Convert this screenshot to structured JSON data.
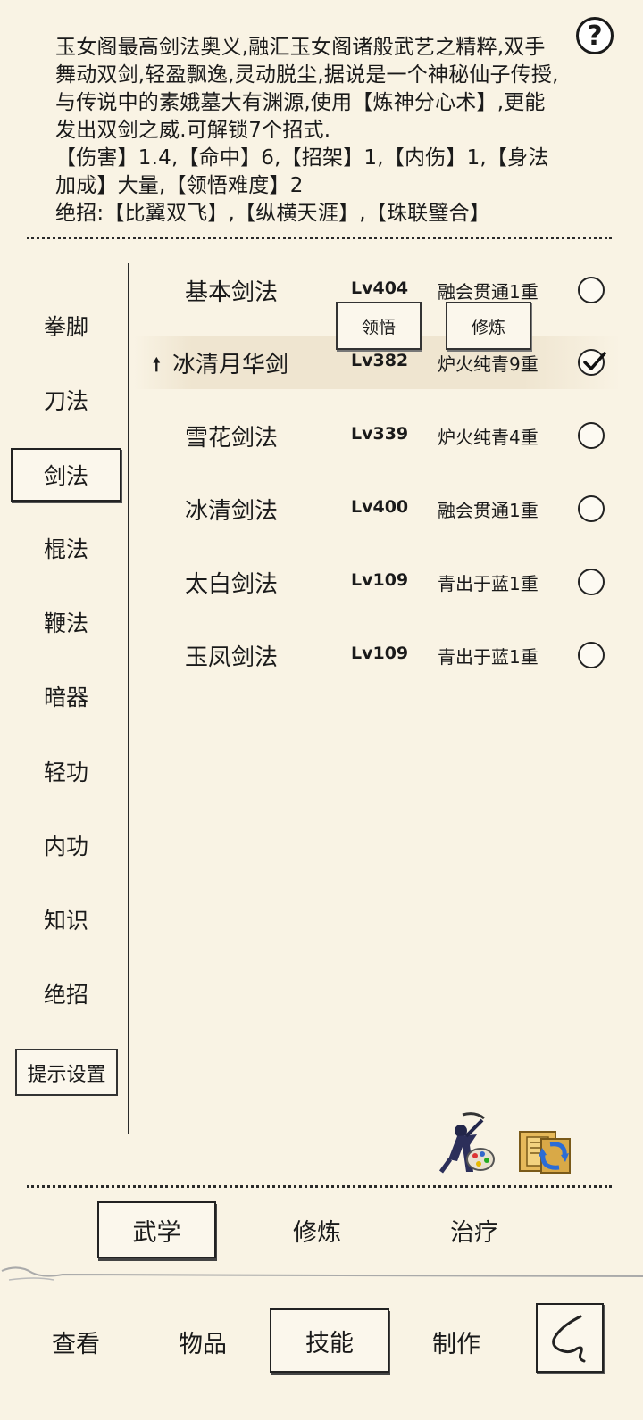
{
  "description": {
    "lines": [
      "玉女阁最高剑法奥义,融汇玉女阁诸般武艺之精粹,双手",
      "舞动双剑,轻盈飘逸,灵动脱尘,据说是一个神秘仙子传授,",
      "与传说中的素娥墓大有渊源,使用【炼神分心术】,更能",
      "发出双剑之威.可解锁7个招式.",
      "【伤害】1.4,【命中】6,【招架】1,【内伤】1,【身法",
      "加成】大量,【领悟难度】2",
      "绝招:【比翼双飞】,【纵横天涯】,【珠联璧合】"
    ]
  },
  "help_icon": "question-icon",
  "sidebar": {
    "items": [
      "拳脚",
      "刀法",
      "剑法",
      "棍法",
      "鞭法",
      "暗器",
      "轻功",
      "内功",
      "知识",
      "绝招"
    ],
    "active": "剑法",
    "hint_button": "提示设置"
  },
  "skills": [
    {
      "name": "基本剑法",
      "level": "Lv404",
      "status": "融会贯通1重",
      "checked": false
    },
    {
      "name": "冰清月华剑",
      "level": "Lv382",
      "status": "炉火纯青9重",
      "checked": true
    },
    {
      "name": "雪花剑法",
      "level": "Lv339",
      "status": "炉火纯青4重",
      "checked": false
    },
    {
      "name": "冰清剑法",
      "level": "Lv400",
      "status": "融会贯通1重",
      "checked": false
    },
    {
      "name": "太白剑法",
      "level": "Lv109",
      "status": "青出于蓝1重",
      "checked": false
    },
    {
      "name": "玉凤剑法",
      "level": "Lv109",
      "status": "青出于蓝1重",
      "checked": false
    }
  ],
  "popup_buttons": {
    "comprehend": "领悟",
    "practice": "修炼"
  },
  "tool_icons": [
    "martial-artist-palette-icon",
    "scroll-swap-icon"
  ],
  "sub_tabs": {
    "items": [
      "武学",
      "修炼",
      "治疗"
    ],
    "active": "武学"
  },
  "bottom_nav": {
    "items": [
      "查看",
      "物品",
      "技能",
      "制作"
    ],
    "active": "技能",
    "back_icon": "back-icon"
  }
}
